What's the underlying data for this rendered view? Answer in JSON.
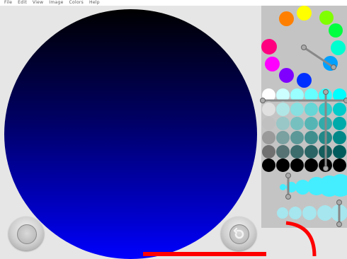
{
  "menu": {
    "items": [
      "File",
      "Edit",
      "View",
      "Image",
      "Colors",
      "Help"
    ]
  },
  "palette": {
    "hue_ring": [
      "#ffff00",
      "#80ff00",
      "#00ff40",
      "#00ffd0",
      "#00a0ff",
      "#0030ff",
      "#8000ff",
      "#ff00ff",
      "#ff0080",
      "#ff8000"
    ],
    "shade_rows": [
      [
        "#ffffff",
        "#ccffff",
        "#99ffff",
        "#66ffff",
        "#33ffff",
        "#00ffff"
      ],
      [
        "#e0e0e0",
        "#b0e6e6",
        "#88e0e0",
        "#66d6d6",
        "#33cccc",
        "#00cccc"
      ],
      [
        "#c0c0c0",
        "#99c6c6",
        "#77c0c0",
        "#55b5b5",
        "#33aaaa",
        "#00aaaa"
      ],
      [
        "#9a9a9a",
        "#7aa0a0",
        "#5c9898",
        "#408f8f",
        "#228888",
        "#008888"
      ],
      [
        "#707070",
        "#567272",
        "#3c6c6c",
        "#2a6464",
        "#155c5c",
        "#005c5c"
      ],
      [
        "#000000",
        "#000000",
        "#000000",
        "#000000",
        "#000000",
        "#000000"
      ]
    ],
    "selected_color": "#0000ff",
    "size_preview_color": "#44eeff"
  },
  "tools": {
    "left_button": "reset-button",
    "right_button": "undo-button"
  }
}
